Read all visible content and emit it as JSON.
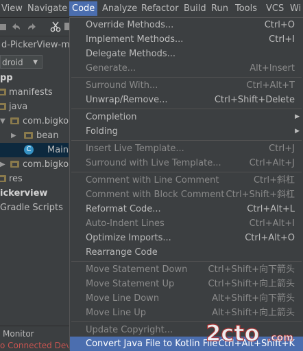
{
  "menubar": {
    "items": [
      {
        "label": "View"
      },
      {
        "label": "Navigate"
      },
      {
        "label": "Code"
      },
      {
        "label": "Analyze"
      },
      {
        "label": "Refactor"
      },
      {
        "label": "Build"
      },
      {
        "label": "Run"
      },
      {
        "label": "Tools"
      },
      {
        "label": "VCS"
      },
      {
        "label": "Wi"
      }
    ]
  },
  "toolbar": {
    "icons": [
      "undo-icon",
      "redo-icon",
      "cut-icon"
    ]
  },
  "project": {
    "crumb": "d-PickerView-ma",
    "selector_value": "droid",
    "tree": [
      {
        "label": "pp",
        "icon": "none"
      },
      {
        "label": "manifests",
        "icon": "folder"
      },
      {
        "label": "java",
        "icon": "folder"
      },
      {
        "label": "com.bigkoo",
        "icon": "folder"
      },
      {
        "label": "bean",
        "icon": "folder"
      },
      {
        "label": "MainA",
        "icon": "class"
      },
      {
        "label": "com.bigkoo",
        "icon": "folder"
      },
      {
        "label": "res",
        "icon": "folder"
      },
      {
        "label": "ickerview",
        "icon": "none"
      },
      {
        "label": "Gradle Scripts",
        "icon": "none"
      }
    ],
    "monitor_tab": "Monitor",
    "status_text": "o Connected Dev"
  },
  "code_menu": {
    "items": [
      {
        "label": "Override Methods...",
        "shortcut": "Ctrl+O",
        "state": "enabled"
      },
      {
        "label": "Implement Methods...",
        "shortcut": "Ctrl+I",
        "state": "enabled"
      },
      {
        "label": "Delegate Methods...",
        "shortcut": "",
        "state": "enabled"
      },
      {
        "label": "Generate...",
        "shortcut": "Alt+Insert",
        "state": "disabled"
      },
      {
        "label": "Surround With...",
        "shortcut": "Ctrl+Alt+T",
        "state": "disabled"
      },
      {
        "label": "Unwrap/Remove...",
        "shortcut": "Ctrl+Shift+Delete",
        "state": "enabled"
      },
      {
        "label": "Completion",
        "shortcut": "",
        "state": "enabled",
        "submenu": true
      },
      {
        "label": "Folding",
        "shortcut": "",
        "state": "enabled",
        "submenu": true
      },
      {
        "label": "Insert Live Template...",
        "shortcut": "Ctrl+J",
        "state": "disabled"
      },
      {
        "label": "Surround with Live Template...",
        "shortcut": "Ctrl+Alt+J",
        "state": "disabled"
      },
      {
        "label": "Comment with Line Comment",
        "shortcut": "Ctrl+斜杠",
        "state": "disabled"
      },
      {
        "label": "Comment with Block Comment",
        "shortcut": "Ctrl+Shift+斜杠",
        "state": "disabled"
      },
      {
        "label": "Reformat Code...",
        "shortcut": "Ctrl+Alt+L",
        "state": "enabled"
      },
      {
        "label": "Auto-Indent Lines",
        "shortcut": "Ctrl+Alt+I",
        "state": "disabled"
      },
      {
        "label": "Optimize Imports...",
        "shortcut": "Ctrl+Alt+O",
        "state": "enabled"
      },
      {
        "label": "Rearrange Code",
        "shortcut": "",
        "state": "enabled"
      },
      {
        "label": "Move Statement Down",
        "shortcut": "Ctrl+Shift+向下箭头",
        "state": "disabled"
      },
      {
        "label": "Move Statement Up",
        "shortcut": "Ctrl+Shift+向上箭头",
        "state": "disabled"
      },
      {
        "label": "Move Line Down",
        "shortcut": "Alt+Shift+向下箭头",
        "state": "disabled"
      },
      {
        "label": "Move Line Up",
        "shortcut": "Alt+Shift+向上箭头",
        "state": "disabled"
      },
      {
        "label": "Update Copyright...",
        "shortcut": "",
        "state": "disabled"
      },
      {
        "label": "Convert Java File to Kotlin File",
        "shortcut": "Ctrl+Alt+Shift+K",
        "state": "highlighted"
      }
    ]
  },
  "watermark": {
    "text": "2cto",
    "subtext": ".com"
  },
  "colors": {
    "accent": "#4b6eaf",
    "background": "#3c3f41",
    "error": "#c75450"
  }
}
